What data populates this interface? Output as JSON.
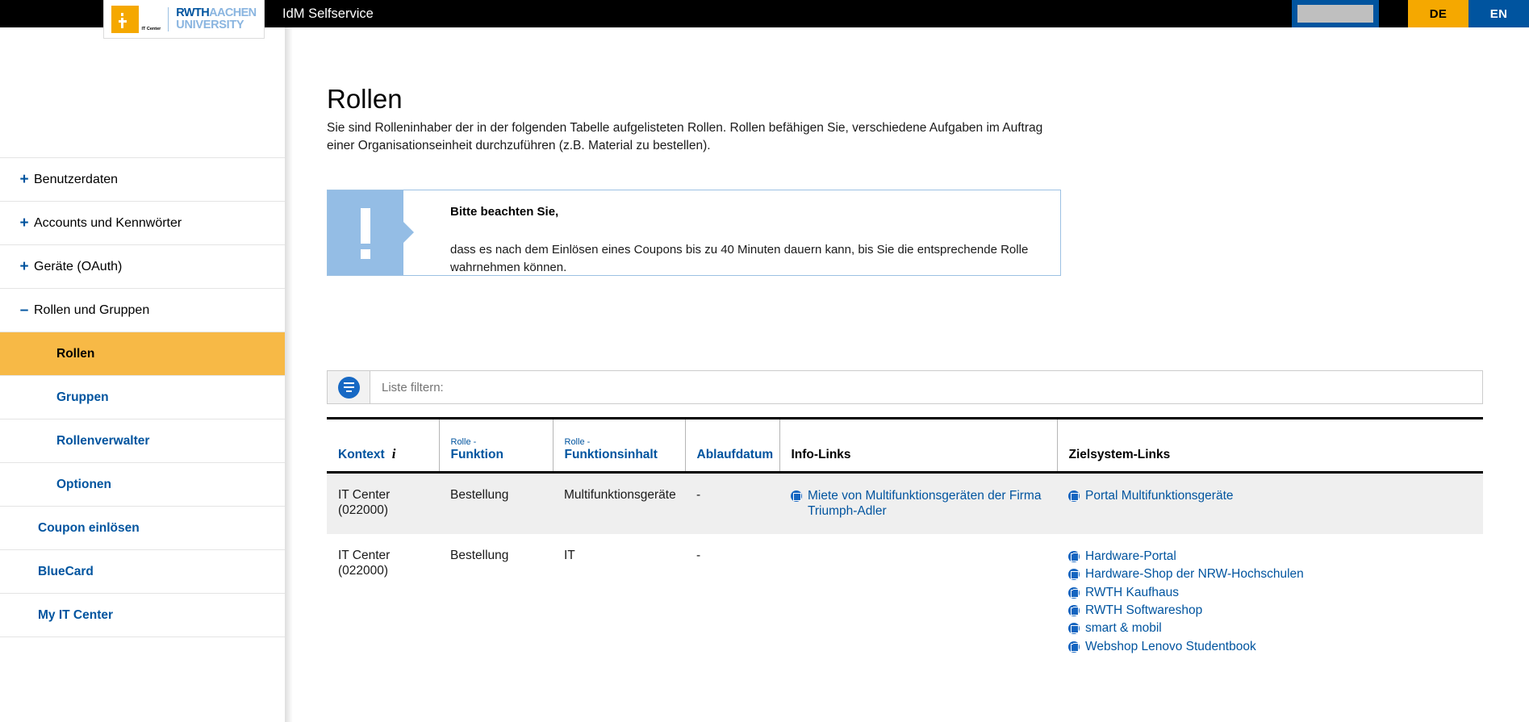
{
  "topbar": {
    "app_title": "IdM Selfservice",
    "user_widget_name": "user-menu",
    "lang_de": "DE",
    "lang_en": "EN",
    "colors": {
      "bar": "#000000",
      "de": "#f5a800",
      "en": "#00549f",
      "accent": "#00549f"
    }
  },
  "logo": {
    "it_center_label": "IT Center",
    "rwth_bold": "RWTH",
    "rwth_light": "AACHEN",
    "rwth_line2": "UNIVERSITY"
  },
  "sidebar": {
    "items": [
      {
        "label": "Benutzerdaten",
        "toggle": "+",
        "level": "top",
        "active": false
      },
      {
        "label": "Accounts und Kennwörter",
        "toggle": "+",
        "level": "top",
        "active": false
      },
      {
        "label": "Geräte (OAuth)",
        "toggle": "+",
        "level": "top",
        "active": false
      },
      {
        "label": "Rollen und Gruppen",
        "toggle": "–",
        "level": "top",
        "active": false
      },
      {
        "label": "Rollen",
        "toggle": "",
        "level": "sub",
        "active": true
      },
      {
        "label": "Gruppen",
        "toggle": "",
        "level": "sub",
        "active": false
      },
      {
        "label": "Rollenverwalter",
        "toggle": "",
        "level": "sub",
        "active": false
      },
      {
        "label": "Optionen",
        "toggle": "",
        "level": "sub",
        "active": false
      },
      {
        "label": "Coupon einlösen",
        "toggle": "",
        "level": "lvl1",
        "active": false
      },
      {
        "label": "BlueCard",
        "toggle": "",
        "level": "lvl1",
        "active": false
      },
      {
        "label": "My IT Center",
        "toggle": "",
        "level": "lvl1",
        "active": false
      }
    ],
    "active_color": "#f7b946"
  },
  "main": {
    "title": "Rollen",
    "description": "Sie sind Rolleninhaber der in der folgenden Tabelle aufgelisteten Rollen. Rollen befähigen Sie, verschiedene Aufgaben im Auftrag einer Organisationseinheit durchzuführen (z.B. Material zu bestellen).",
    "alert": {
      "icon": "exclamation-icon",
      "title": "Bitte beachten Sie,",
      "text": "dass es nach dem Einlösen eines Coupons bis zu 40 Minuten dauern kann, bis Sie die entsprechende Rolle wahrnehmen können.",
      "bar_color": "#94bde5"
    },
    "filter": {
      "icon": "filter-icon",
      "placeholder": "Liste filtern:",
      "value": ""
    },
    "table": {
      "columns": [
        {
          "pre": "",
          "label": "Kontext",
          "has_info": true,
          "style": "link"
        },
        {
          "pre": "Rolle -",
          "label": "Funktion",
          "has_info": false,
          "style": "link"
        },
        {
          "pre": "Rolle -",
          "label": "Funktionsinhalt",
          "has_info": false,
          "style": "link"
        },
        {
          "pre": "",
          "label": "Ablaufdatum",
          "has_info": false,
          "style": "link"
        },
        {
          "pre": "",
          "label": "Info-Links",
          "has_info": false,
          "style": "plain"
        },
        {
          "pre": "",
          "label": "Zielsystem-Links",
          "has_info": false,
          "style": "plain"
        }
      ],
      "rows": [
        {
          "kontext": "IT Center (022000)",
          "funktion": "Bestellung",
          "funktionsinhalt": "Multifunktionsgeräte",
          "ablaufdatum": "-",
          "info_links": [
            "Miete von Multifunktionsgeräten der Firma Triumph-Adler"
          ],
          "zielsystem_links": [
            "Portal Multifunktionsgeräte"
          ]
        },
        {
          "kontext": "IT Center (022000)",
          "funktion": "Bestellung",
          "funktionsinhalt": "IT",
          "ablaufdatum": "-",
          "info_links": [],
          "zielsystem_links": [
            "Hardware-Portal",
            "Hardware-Shop der NRW-Hochschulen",
            "RWTH Kaufhaus",
            "RWTH Softwareshop",
            "smart & mobil",
            "Webshop Lenovo Studentbook"
          ]
        }
      ]
    }
  }
}
